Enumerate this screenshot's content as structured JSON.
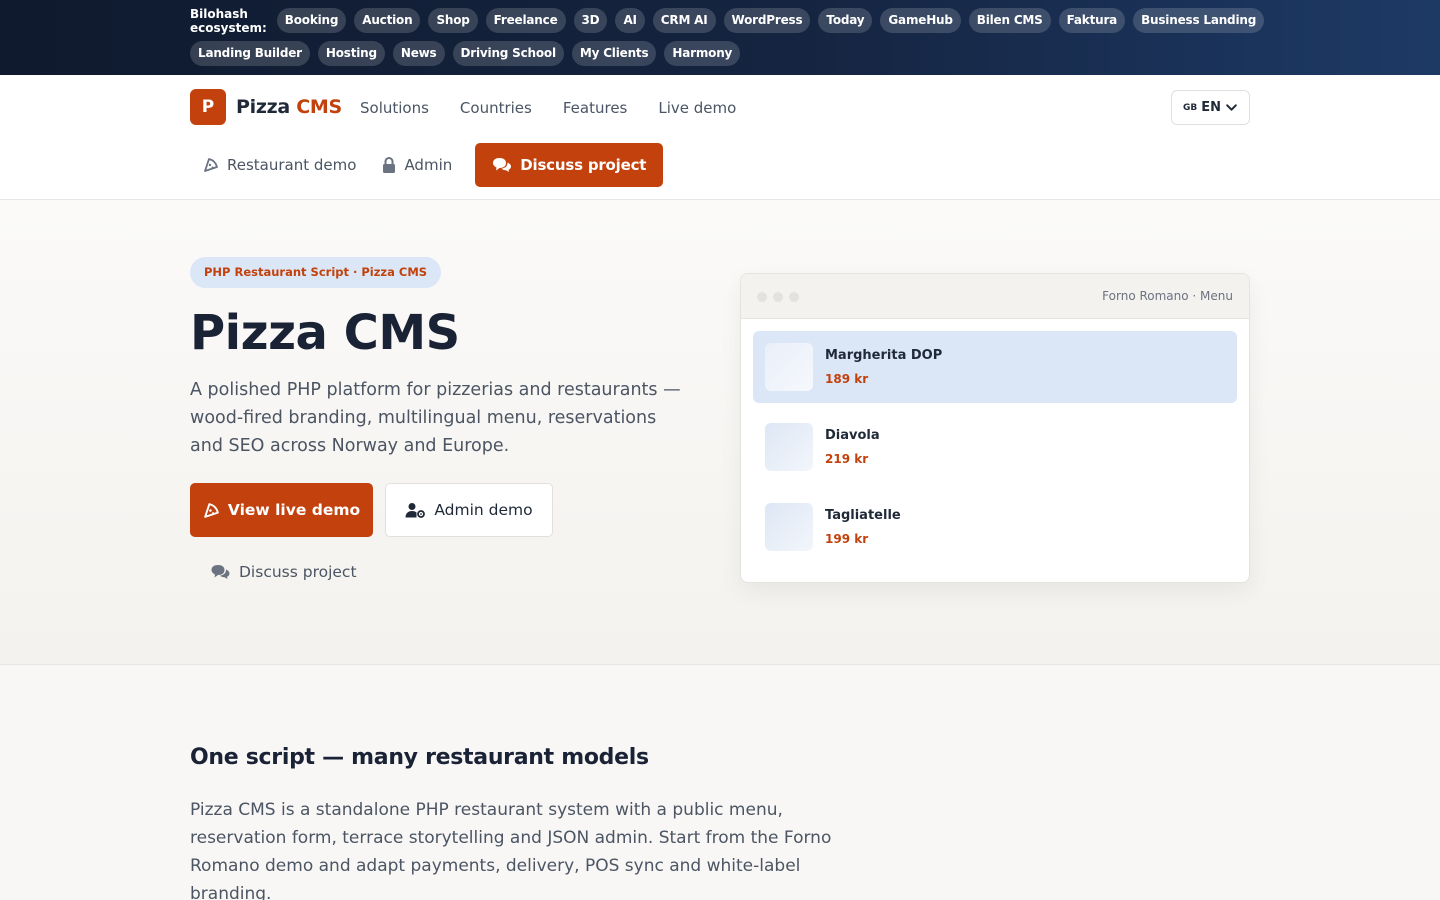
{
  "ecosystem": {
    "title": "Bilohash ecosystem:",
    "row1": [
      "Booking",
      "Auction",
      "Shop",
      "Freelance",
      "3D",
      "AI",
      "CRM AI",
      "WordPress",
      "Today",
      "GameHub",
      "Bilen CMS",
      "Faktura",
      "Business Landing"
    ],
    "row2": [
      "Landing Builder",
      "Hosting",
      "News",
      "Driving School",
      "My Clients",
      "Harmony"
    ]
  },
  "header": {
    "logo_letter": "P",
    "brand_main": "Pizza",
    "brand_accent": "CMS",
    "nav": [
      "Solutions",
      "Countries",
      "Features",
      "Live demo"
    ],
    "lang_flag": "GB",
    "lang_code": "EN",
    "restaurant_demo": "Restaurant demo",
    "admin": "Admin",
    "discuss": "Discuss project"
  },
  "hero": {
    "badge": "PHP Restaurant Script · Pizza CMS",
    "title": "Pizza CMS",
    "lead": "A polished PHP platform for pizzerias and restaurants — wood-fired branding, multilingual menu, reservations and SEO across Norway and Europe.",
    "cta_live": "View live demo",
    "cta_admin": "Admin demo",
    "cta_discuss": "Discuss project"
  },
  "menu_card": {
    "title": "Forno Romano · Menu",
    "items": [
      {
        "name": "Margherita DOP",
        "price": "189 kr"
      },
      {
        "name": "Diavola",
        "price": "219 kr"
      },
      {
        "name": "Tagliatelle",
        "price": "199 kr"
      }
    ]
  },
  "section": {
    "heading": "One script — many restaurant models",
    "body": "Pizza CMS is a standalone PHP restaurant system with a public menu, reservation form, terrace storytelling and JSON admin. Start from the Forno Romano demo and adapt payments, delivery, POS sync and white-label branding."
  },
  "colors": {
    "accent": "#c2410c",
    "ecosystem_bg": "#152440",
    "badge_bg": "#dbe6f7"
  },
  "icons": [
    "pizza-icon",
    "lock-icon",
    "comments-icon",
    "user-gear-icon",
    "chevron-down-icon"
  ]
}
